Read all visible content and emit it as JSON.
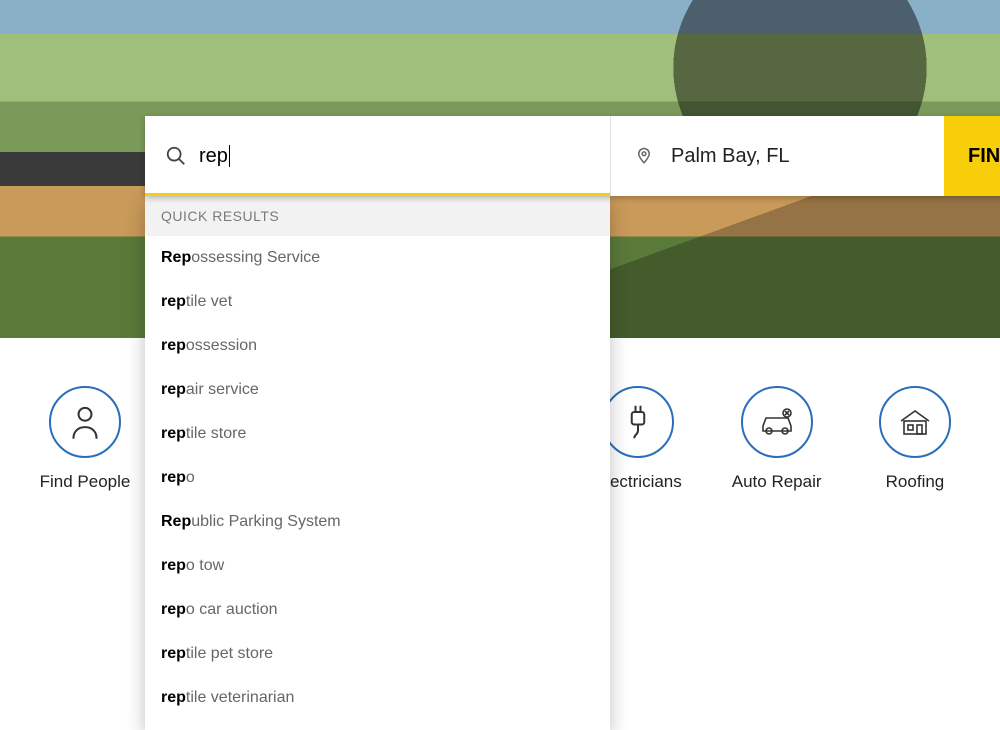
{
  "search": {
    "query": "rep",
    "location": "Palm Bay, FL",
    "button_label": "FIND"
  },
  "dropdown": {
    "header": "QUICK RESULTS",
    "items": [
      {
        "prefix": "Rep",
        "rest": "ossessing Service"
      },
      {
        "prefix": "rep",
        "rest": "tile vet"
      },
      {
        "prefix": "rep",
        "rest": "ossession"
      },
      {
        "prefix": "rep",
        "rest": "air service"
      },
      {
        "prefix": "rep",
        "rest": "tile store"
      },
      {
        "prefix": "rep",
        "rest": "o"
      },
      {
        "prefix": "Rep",
        "rest": "ublic Parking System"
      },
      {
        "prefix": "rep",
        "rest": "o tow"
      },
      {
        "prefix": "rep",
        "rest": "o car auction"
      },
      {
        "prefix": "rep",
        "rest": "tile pet store"
      },
      {
        "prefix": "rep",
        "rest": "tile veterinarian"
      }
    ]
  },
  "categories": [
    {
      "id": "find-people",
      "label": "Find People",
      "icon": "person"
    },
    {
      "id": "spacer1",
      "label": "",
      "icon": "",
      "spacer": true
    },
    {
      "id": "spacer2",
      "label": "",
      "icon": "",
      "spacer": true
    },
    {
      "id": "spacer3",
      "label": "",
      "icon": "",
      "spacer": true
    },
    {
      "id": "electricians",
      "label": "Electricians",
      "icon": "plug"
    },
    {
      "id": "auto-repair",
      "label": "Auto Repair",
      "icon": "car"
    },
    {
      "id": "roofing",
      "label": "Roofing",
      "icon": "house"
    }
  ]
}
